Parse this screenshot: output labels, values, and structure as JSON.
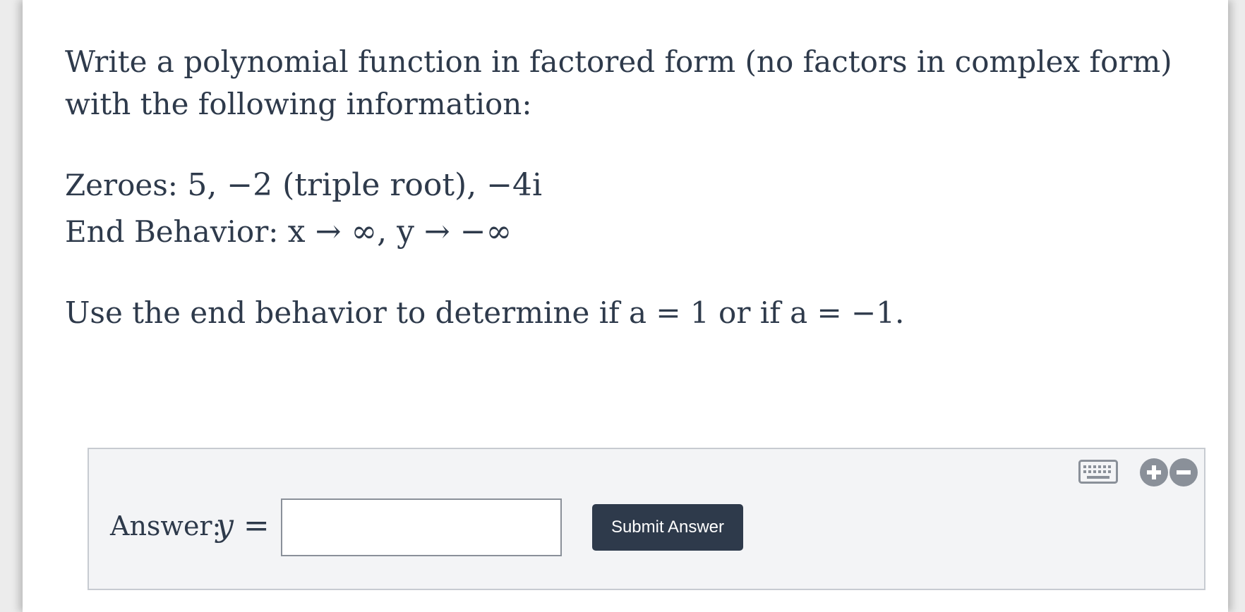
{
  "question": {
    "intro": "Write a polynomial function in factored form (no factors in complex form) with the following information:",
    "zeroes_label": "Zeroes:",
    "zeroes_value": "5, −2 (triple root), −4i",
    "end_behavior_label": "End Behavior:",
    "end_behavior_value": "x → ∞, y → −∞",
    "hint": "Use the end behavior to determine if a = 1 or if a = −1."
  },
  "answer": {
    "label": "Answer:",
    "equation_prefix": "y =",
    "input_value": "",
    "submit_label": "Submit Answer"
  },
  "icons": {
    "keyboard": "keyboard-icon",
    "zoom_in": "plus-circle-icon",
    "zoom_out": "minus-circle-icon"
  },
  "colors": {
    "text": "#2e3a4b",
    "button_bg": "#2e3a4b",
    "button_text": "#ffffff",
    "answer_panel_bg": "#f3f4f6",
    "icon": "#8a9099"
  }
}
